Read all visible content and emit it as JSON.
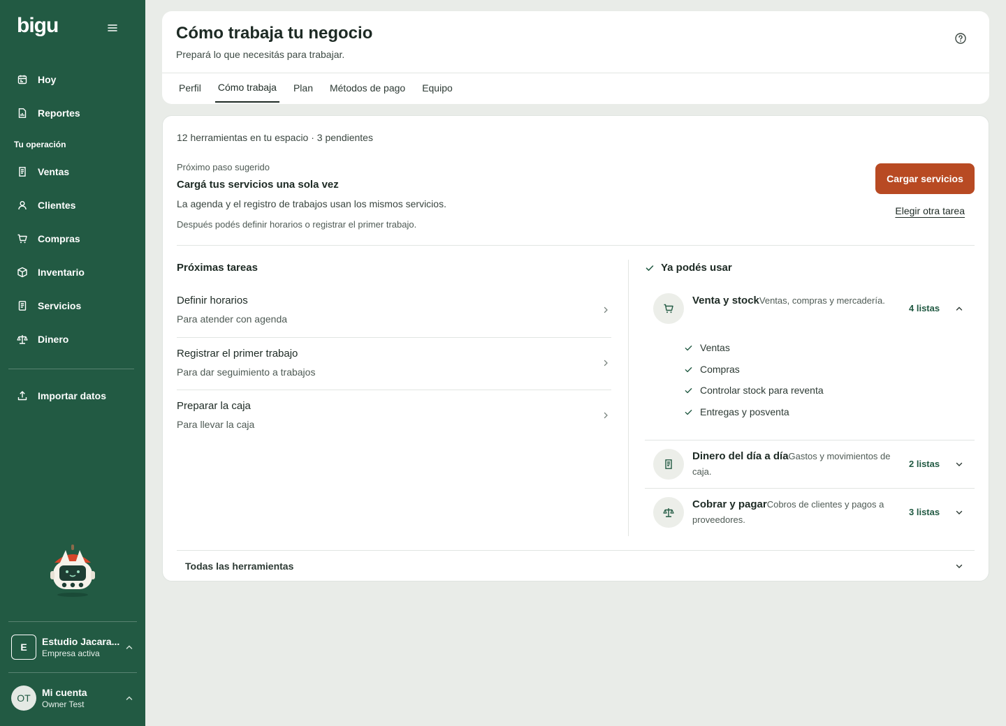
{
  "sidebar": {
    "logo": "bigu",
    "top_items": [
      {
        "label": "Hoy",
        "icon": "calendar-icon"
      },
      {
        "label": "Reportes",
        "icon": "report-icon"
      }
    ],
    "section_label": "Tu operación",
    "ops_items": [
      {
        "label": "Ventas",
        "icon": "receipt-icon"
      },
      {
        "label": "Clientes",
        "icon": "user-icon"
      },
      {
        "label": "Compras",
        "icon": "cart-icon"
      },
      {
        "label": "Inventario",
        "icon": "box-icon"
      },
      {
        "label": "Servicios",
        "icon": "document-icon"
      },
      {
        "label": "Dinero",
        "icon": "scale-icon"
      }
    ],
    "import_label": "Importar datos",
    "company": {
      "initial": "E",
      "name": "Estudio Jacara...",
      "status": "Empresa activa"
    },
    "account": {
      "initials": "OT",
      "name": "Mi cuenta",
      "user": "Owner Test"
    }
  },
  "header": {
    "title": "Cómo trabaja tu negocio",
    "subtitle": "Prepará lo que necesitás para trabajar.",
    "tabs": [
      "Perfil",
      "Cómo trabaja",
      "Plan",
      "Métodos de pago",
      "Equipo"
    ],
    "active_tab": "Cómo trabaja"
  },
  "main": {
    "summary": "12 herramientas en tu espacio · 3 pendientes",
    "suggestion": {
      "label": "Próximo paso sugerido",
      "title": "Cargá tus servicios una sola vez",
      "description": "La agenda y el registro de trabajos usan los mismos servicios.",
      "note": "Después podés definir horarios o registrar el primer trabajo.",
      "primary_button": "Cargar servicios",
      "secondary_link": "Elegir otra tarea"
    },
    "tasks_title": "Próximas tareas",
    "tasks": [
      {
        "title": "Definir horarios",
        "subtitle": "Para atender con agenda"
      },
      {
        "title": "Registrar el primer trabajo",
        "subtitle": "Para dar seguimiento a trabajos"
      },
      {
        "title": "Preparar la caja",
        "subtitle": "Para llevar la caja"
      }
    ],
    "ready_title": "Ya podés usar",
    "groups": [
      {
        "name": "Venta y stock",
        "description": "Ventas, compras y mercadería.",
        "count": "4 listas",
        "icon": "cart-icon",
        "expanded": true,
        "items": [
          "Ventas",
          "Compras",
          "Controlar stock para reventa",
          "Entregas y posventa"
        ]
      },
      {
        "name": "Dinero del día a día",
        "description": "Gastos y movimientos de caja.",
        "count": "2 listas",
        "icon": "receipt-icon",
        "expanded": false
      },
      {
        "name": "Cobrar y pagar",
        "description": "Cobros de clientes y pagos a proveedores.",
        "count": "3 listas",
        "icon": "scale-icon",
        "expanded": false
      }
    ],
    "all_tools_label": "Todas las herramientas"
  },
  "colors": {
    "sidebar_bg": "#225a43",
    "accent": "#b84a23",
    "page_bg": "#e9ece8",
    "link_green": "#225a43"
  }
}
